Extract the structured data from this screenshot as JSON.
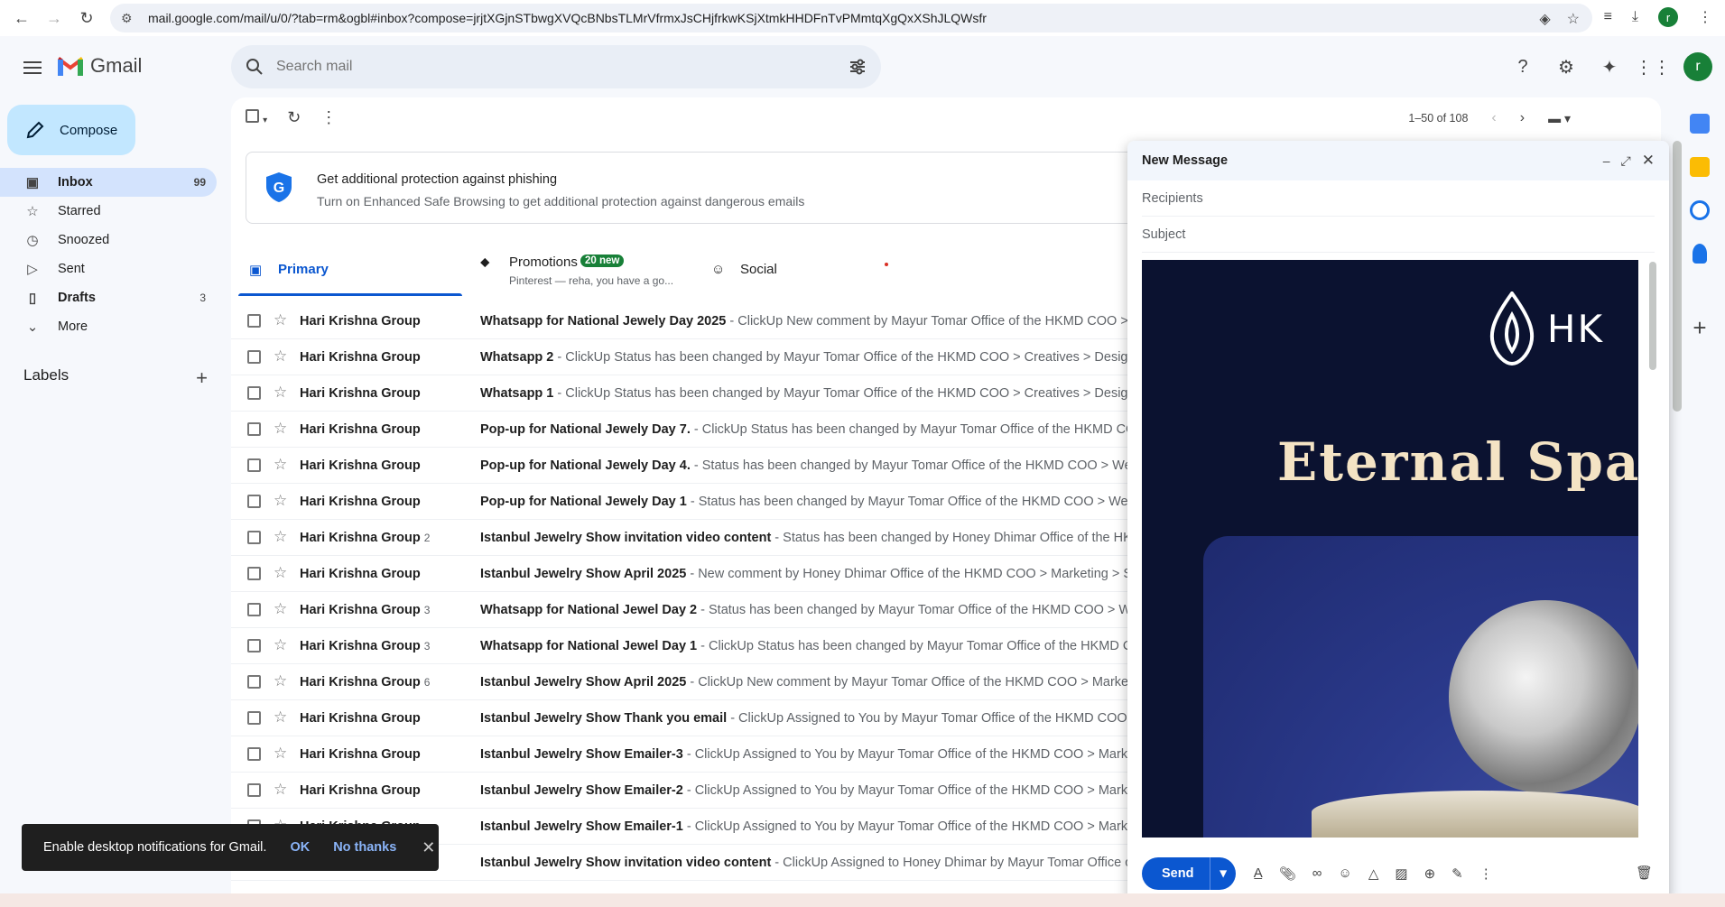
{
  "browser": {
    "url": "mail.google.com/mail/u/0/?tab=rm&ogbl#inbox?compose=jrjtXGjnSTbwgXVQcBNbsTLMrVfrmxJsCHjfrkwKSjXtmkHHDFnTvPMmtqXgQxXShJLQWsfr",
    "profile_initial": "r"
  },
  "app": {
    "name": "Gmail",
    "search_placeholder": "Search mail",
    "avatar_initial": "r"
  },
  "sidebar": {
    "compose_label": "Compose",
    "items": [
      {
        "label": "Inbox",
        "count": "99",
        "icon": "inbox-icon"
      },
      {
        "label": "Starred",
        "count": "",
        "icon": "star-icon"
      },
      {
        "label": "Snoozed",
        "count": "",
        "icon": "clock-icon"
      },
      {
        "label": "Sent",
        "count": "",
        "icon": "send-icon"
      },
      {
        "label": "Drafts",
        "count": "3",
        "icon": "draft-icon"
      },
      {
        "label": "More",
        "count": "",
        "icon": "chevron-down-icon"
      }
    ],
    "labels_heading": "Labels"
  },
  "toolbar": {
    "pagination": "1–50 of 108"
  },
  "banner": {
    "title": "Get additional protection against phishing",
    "subtitle": "Turn on Enhanced Safe Browsing to get additional protection against dangerous emails"
  },
  "tabs": [
    {
      "label": "Primary"
    },
    {
      "label": "Promotions",
      "badge": "20 new",
      "preview": "Pinterest — reha, you have a go..."
    },
    {
      "label": "Social"
    }
  ],
  "emails": [
    {
      "sender": "Hari Krishna Group",
      "count": "",
      "subject": "Whatsapp for National Jewely Day 2025",
      "snippet": " - ClickUp New comment by Mayur Tomar Office of the HKMD COO > C"
    },
    {
      "sender": "Hari Krishna Group",
      "count": "",
      "subject": "Whatsapp 2",
      "snippet": " - ClickUp Status has been changed by Mayur Tomar Office of the HKMD COO > Creatives > Designs"
    },
    {
      "sender": "Hari Krishna Group",
      "count": "",
      "subject": "Whatsapp 1",
      "snippet": " - ClickUp Status has been changed by Mayur Tomar Office of the HKMD COO > Creatives > Designs V"
    },
    {
      "sender": "Hari Krishna Group",
      "count": "",
      "subject": "Pop-up for National Jewely Day 7.",
      "snippet": " - ClickUp Status has been changed by Mayur Tomar Office of the HKMD COO"
    },
    {
      "sender": "Hari Krishna Group",
      "count": "",
      "subject": "Pop-up for National Jewely Day 4.",
      "snippet": " - Status has been changed by Mayur Tomar Office of the HKMD COO > Web"
    },
    {
      "sender": "Hari Krishna Group",
      "count": "",
      "subject": "Pop-up for National Jewely Day 1",
      "snippet": " - Status has been changed by Mayur Tomar Office of the HKMD COO > Webs"
    },
    {
      "sender": "Hari Krishna Group",
      "count": "2",
      "subject": "Istanbul Jewelry Show invitation video content",
      "snippet": " - Status has been changed by Honey Dhimar Office of the HKM"
    },
    {
      "sender": "Hari Krishna Group",
      "count": "",
      "subject": "Istanbul Jewelry Show April 2025",
      "snippet": " - New comment by Honey Dhimar Office of the HKMD COO > Marketing > Spe"
    },
    {
      "sender": "Hari Krishna Group",
      "count": "3",
      "subject": "Whatsapp for National Jewel Day 2",
      "snippet": " - Status has been changed by Mayur Tomar Office of the HKMD COO > Web"
    },
    {
      "sender": "Hari Krishna Group",
      "count": "3",
      "subject": "Whatsapp for National Jewel Day 1",
      "snippet": " - ClickUp Status has been changed by Mayur Tomar Office of the HKMD CO"
    },
    {
      "sender": "Hari Krishna Group",
      "count": "6",
      "subject": "Istanbul Jewelry Show April 2025",
      "snippet": " - ClickUp New comment by Mayur Tomar Office of the HKMD COO > Marketin"
    },
    {
      "sender": "Hari Krishna Group",
      "count": "",
      "subject": "Istanbul Jewelry Show Thank you email",
      "snippet": " - ClickUp Assigned to You by Mayur Tomar Office of the HKMD COO >"
    },
    {
      "sender": "Hari Krishna Group",
      "count": "",
      "subject": "Istanbul Jewelry Show Emailer-3",
      "snippet": " - ClickUp Assigned to You by Mayur Tomar Office of the HKMD COO > Marketi"
    },
    {
      "sender": "Hari Krishna Group",
      "count": "",
      "subject": "Istanbul Jewelry Show Emailer-2",
      "snippet": " - ClickUp Assigned to You by Mayur Tomar Office of the HKMD COO > Marketi"
    },
    {
      "sender": "Hari Krishna Group",
      "count": "",
      "subject": "Istanbul Jewelry Show Emailer-1",
      "snippet": " - ClickUp Assigned to You by Mayur Tomar Office of the HKMD COO > Marketi"
    },
    {
      "sender": "Hari Krishna Group",
      "count": "",
      "subject": "Istanbul Jewelry Show invitation video content",
      "snippet": " - ClickUp Assigned to Honey Dhimar by Mayur Tomar Office of"
    }
  ],
  "compose_window": {
    "title": "New Message",
    "recipients_placeholder": "Recipients",
    "subject_placeholder": "Subject",
    "hero_logo_text": "HK",
    "hero_title": "Eternal Spark",
    "send_label": "Send"
  },
  "toast": {
    "message": "Enable desktop notifications for Gmail.",
    "ok": "OK",
    "no_thanks": "No thanks"
  },
  "colors": {
    "accent": "#0b57d0",
    "compose_bg": "#c2e7ff",
    "active_nav": "#d3e3fd",
    "badge_green": "#188038"
  }
}
